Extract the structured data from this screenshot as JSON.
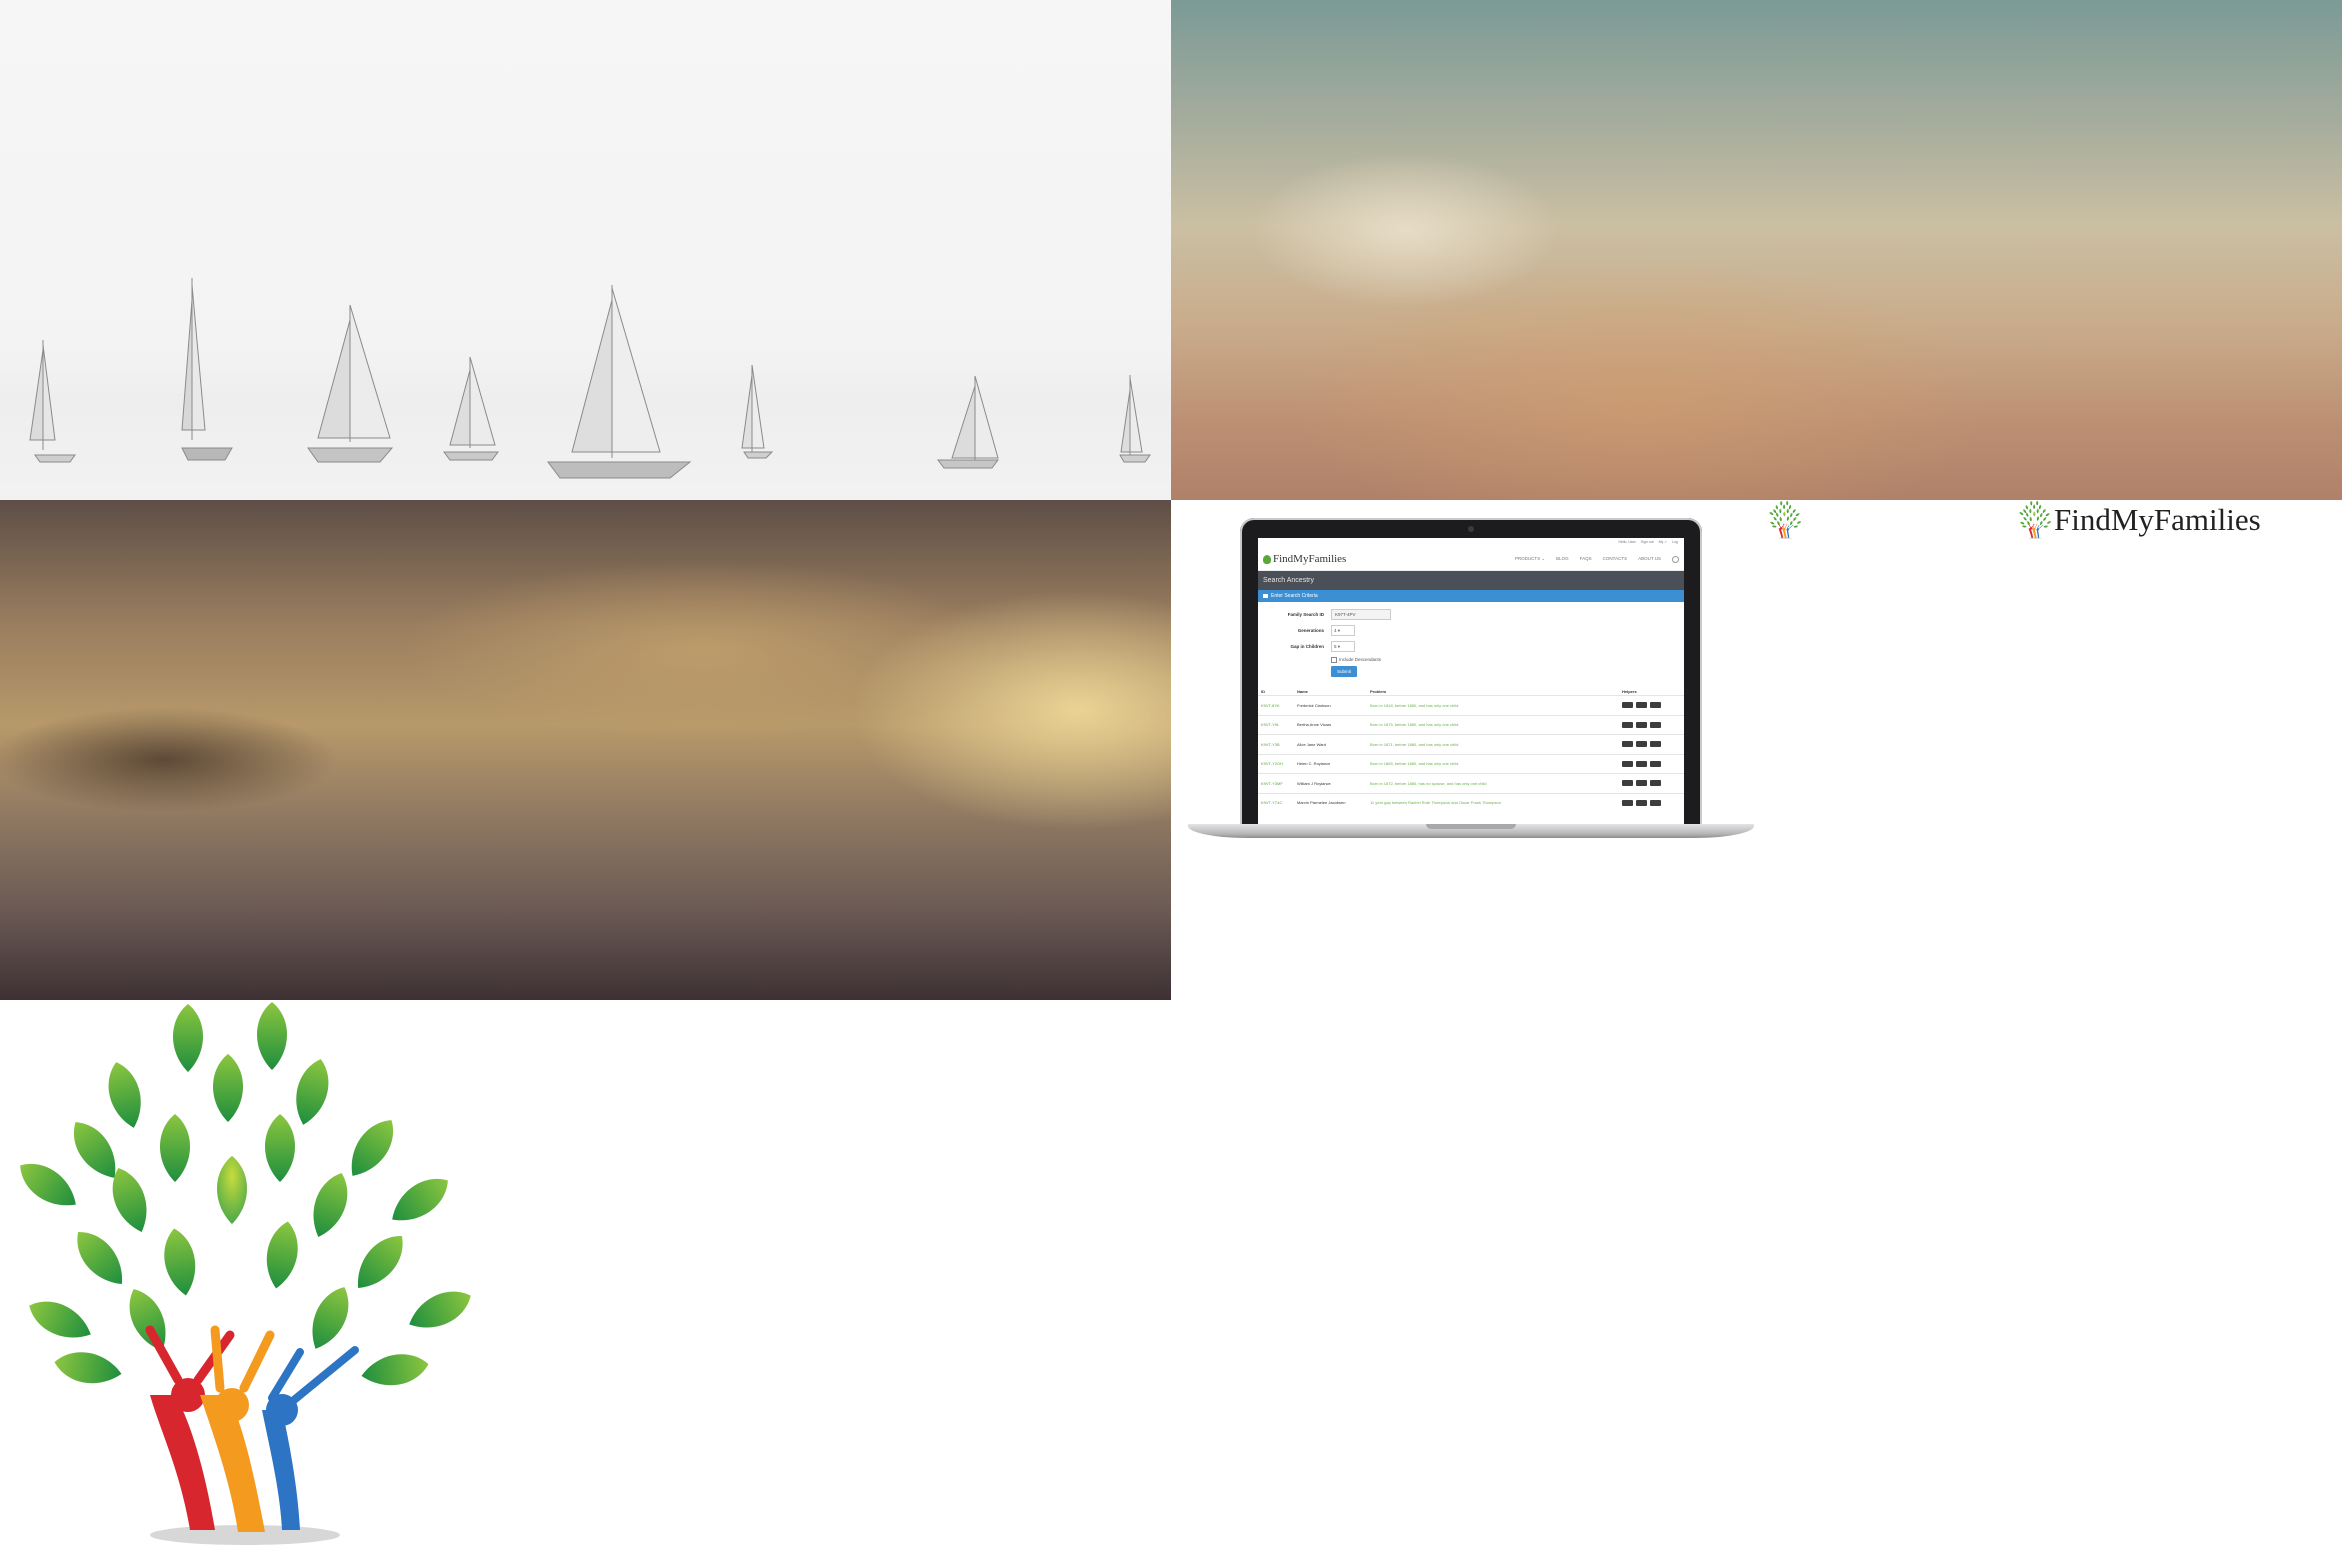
{
  "brand": {
    "name": "FindMyFamilies"
  },
  "laptop_screen": {
    "top_links": [
      "Hello, User",
      "Sign out",
      "My ✓",
      "Log"
    ],
    "logo": "FindMyFamilies",
    "nav": [
      "PRODUCTS ⌄",
      "BLOG",
      "FAQS",
      "CONTACTS",
      "ABOUT US"
    ],
    "page_title": "Search Ancestry",
    "panel_title": "Enter Search Criteria",
    "form": {
      "family_search_id_label": "Family Search ID",
      "family_search_id_value": "K97T-4PV",
      "generations_label": "Generations",
      "generations_value": "4",
      "gap_label": "Gap in Children",
      "gap_value": "5",
      "include_descendants": "Include Descendants",
      "submit": "Submit"
    },
    "table": {
      "headers": [
        "ID",
        "Name",
        "Problem",
        "Helpers"
      ],
      "rows": [
        {
          "id": "K9VT-8YK",
          "name": "Frederick Clarkson",
          "problem": "Born in 1818, before 1880, and has only one child"
        },
        {
          "id": "K9VT-Y9L",
          "name": "Bertha Anne Vicars",
          "problem": "Born in 1875, before 1880, and has only one child"
        },
        {
          "id": "K9VT-Y3B",
          "name": "Alice Jane Ward",
          "problem": "Born in 1871, before 1880, and has only one child"
        },
        {
          "id": "K9VT-Y2GH",
          "name": "Helen C. Roylance",
          "problem": "Born in 1865, before 1880, and has only one child"
        },
        {
          "id": "K9VT-Y3MF",
          "name": "William J Roylance",
          "problem": "Born in 1872, before 1880, has no spouse, and has only one child"
        },
        {
          "id": "K9VT-YT4C",
          "name": "Marvin Parmelee Jacobsen",
          "problem": "11 year gap between Rachel Ruth Thompson and Oscar Frank Thompson"
        }
      ]
    }
  },
  "colors": {
    "accent_blue": "#3d8fd4",
    "brand_green": "#5aa83a",
    "header_band": "#4a4f58"
  },
  "icons": [
    "sailboats-photo",
    "blurred-sky-photo",
    "blurred-dunes-photo",
    "laptop-mockup",
    "family-tree-logo-icon",
    "search-icon"
  ]
}
